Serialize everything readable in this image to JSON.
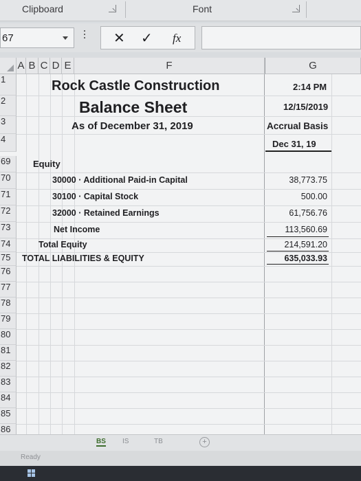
{
  "ribbon": {
    "clipboard_label": "Clipboard",
    "font_label": "Font"
  },
  "formula_bar": {
    "name_box": "67",
    "cancel_symbol": "✕",
    "enter_symbol": "✓",
    "fx_symbol": "fx",
    "formula": ""
  },
  "columns": [
    "A",
    "B",
    "C",
    "D",
    "E",
    "F",
    "G"
  ],
  "report": {
    "company": "Rock Castle Construction",
    "title": "Balance Sheet",
    "as_of": "As of December 31, 2019",
    "time": "2:14 PM",
    "date": "12/15/2019",
    "basis": "Accrual Basis",
    "column_heading": "Dec 31, 19"
  },
  "header_row_numbers": [
    "1",
    "2",
    "3",
    "4"
  ],
  "rows": [
    {
      "num": "69",
      "label": "Equity",
      "value": "",
      "indent": 1,
      "bold": true
    },
    {
      "num": "70",
      "label": "30000 · Additional Paid-in Capital",
      "value": "38,773.75",
      "indent": 2,
      "bold": true
    },
    {
      "num": "71",
      "label": "30100 · Capital Stock",
      "value": "500.00",
      "indent": 2,
      "bold": true
    },
    {
      "num": "72",
      "label": "32000 · Retained Earnings",
      "value": "61,756.76",
      "indent": 2,
      "bold": true
    },
    {
      "num": "73",
      "label": "Net Income",
      "value": "113,560.69",
      "indent": 2,
      "bold": true
    },
    {
      "num": "74",
      "label": "Total Equity",
      "value": "214,591.20",
      "indent": 1,
      "bold": true
    },
    {
      "num": "75",
      "label": "TOTAL LIABILITIES & EQUITY",
      "value": "635,033.93",
      "indent": 0,
      "bold": true
    }
  ],
  "empty_rows": [
    "76",
    "77",
    "78",
    "79",
    "80",
    "81",
    "82",
    "83",
    "84",
    "85",
    "86"
  ],
  "sheet_tabs": [
    "BS",
    "IS",
    "TB"
  ],
  "add_sheet_symbol": "+",
  "status": "Ready",
  "colors": {
    "active_tab": "#3e6d2e",
    "grid_background": "#f2f3f4"
  }
}
